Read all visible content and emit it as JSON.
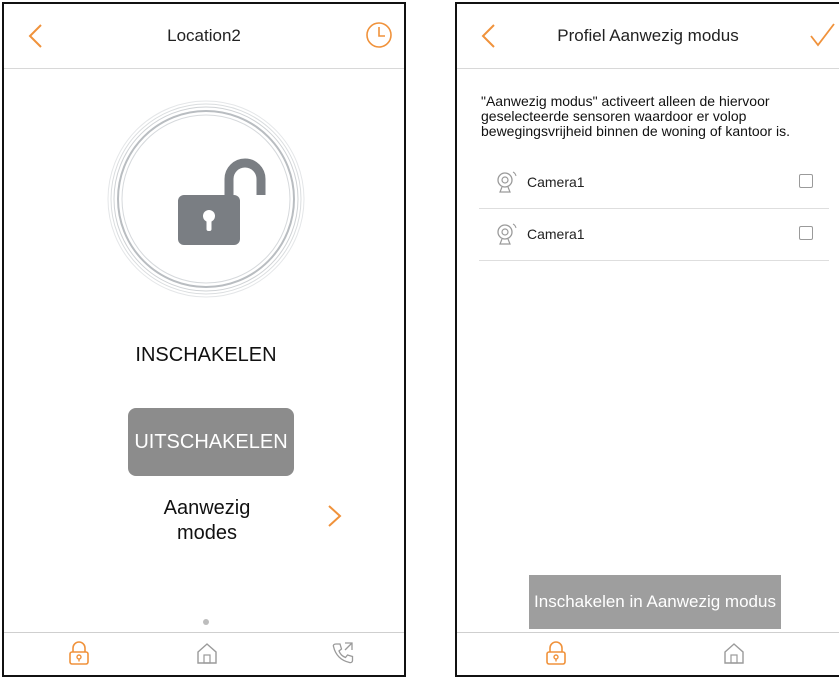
{
  "left_screen": {
    "header": {
      "title": "Location2"
    },
    "status_text": "INSCHAKELEN",
    "off_button_label": "UITSCHAKELEN",
    "modes_label": "Aanwezig modes",
    "page_indicator": {
      "current": 1,
      "total": 1
    },
    "tabs": [
      {
        "icon": "lock-icon",
        "active": true
      },
      {
        "icon": "home-icon",
        "active": false
      },
      {
        "icon": "phone-call-icon",
        "active": false
      }
    ]
  },
  "right_screen": {
    "header": {
      "title": "Profiel Aanwezig modus"
    },
    "description": "\"Aanwezig modus\" activeert alleen de hiervoor geselecteerde sensoren waardoor er volop bewegingsvrijheid binnen de woning of kantoor is.",
    "cameras": [
      {
        "label": "Camera1",
        "checked": false
      },
      {
        "label": "Camera1",
        "checked": false
      }
    ],
    "enable_button_label": "Inschakelen in Aanwezig modus",
    "tabs": [
      {
        "icon": "lock-icon",
        "active": true
      },
      {
        "icon": "home-icon",
        "active": false
      }
    ]
  },
  "colors": {
    "accent": "#f0923b",
    "button_gray": "#8c8c8c",
    "lock_gray": "#7a7e83",
    "ring": "#b9bdc1"
  }
}
